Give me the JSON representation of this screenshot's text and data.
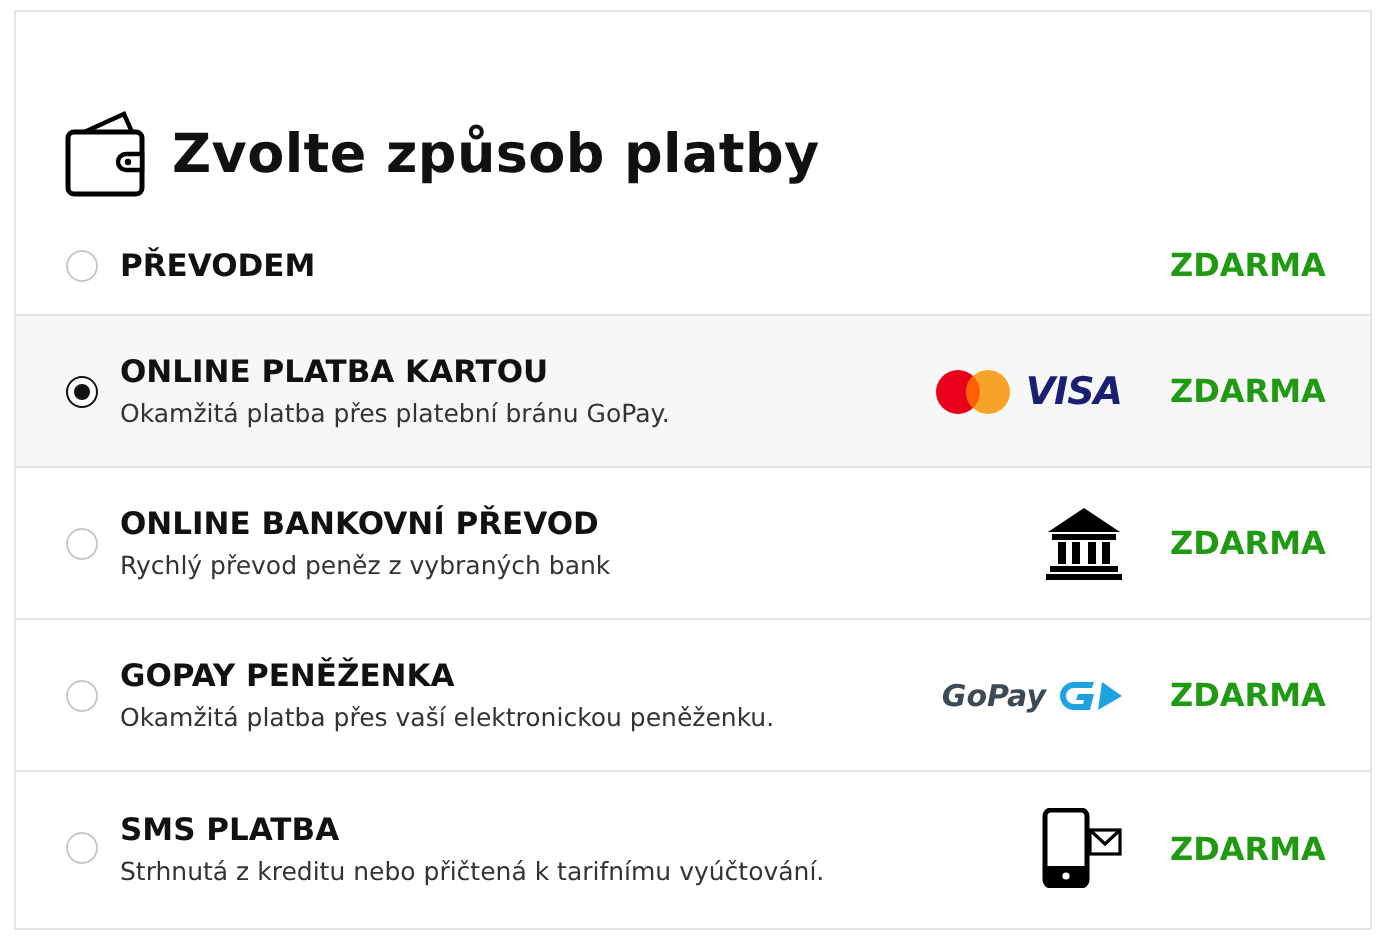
{
  "title": "Zvolte způsob platby",
  "methods": [
    {
      "name": "PŘEVODEM",
      "selected": false,
      "price": "ZDARMA"
    },
    {
      "name": "ONLINE PLATBA KARTOU",
      "description": "Okamžitá platba přes platební bránu GoPay.",
      "selected": true,
      "logo": {
        "kind": "cards",
        "text": "VISA"
      },
      "price": "ZDARMA"
    },
    {
      "name": "ONLINE BANKOVNÍ PŘEVOD",
      "description": "Rychlý převod peněz z vybraných bank",
      "selected": false,
      "logo": {
        "kind": "bank"
      },
      "price": "ZDARMA"
    },
    {
      "name": "GOPAY PENĚŽENKA",
      "description": "Okamžitá platba přes vaší elektronickou peněženku.",
      "selected": false,
      "logo": {
        "kind": "gopay",
        "text": "GoPay"
      },
      "price": "ZDARMA"
    },
    {
      "name": "SMS PLATBA",
      "description": "Strhnutá z kreditu nebo přičtená k tarifnímu vyúčtování.",
      "selected": false,
      "logo": {
        "kind": "phone"
      },
      "price": "ZDARMA"
    }
  ]
}
